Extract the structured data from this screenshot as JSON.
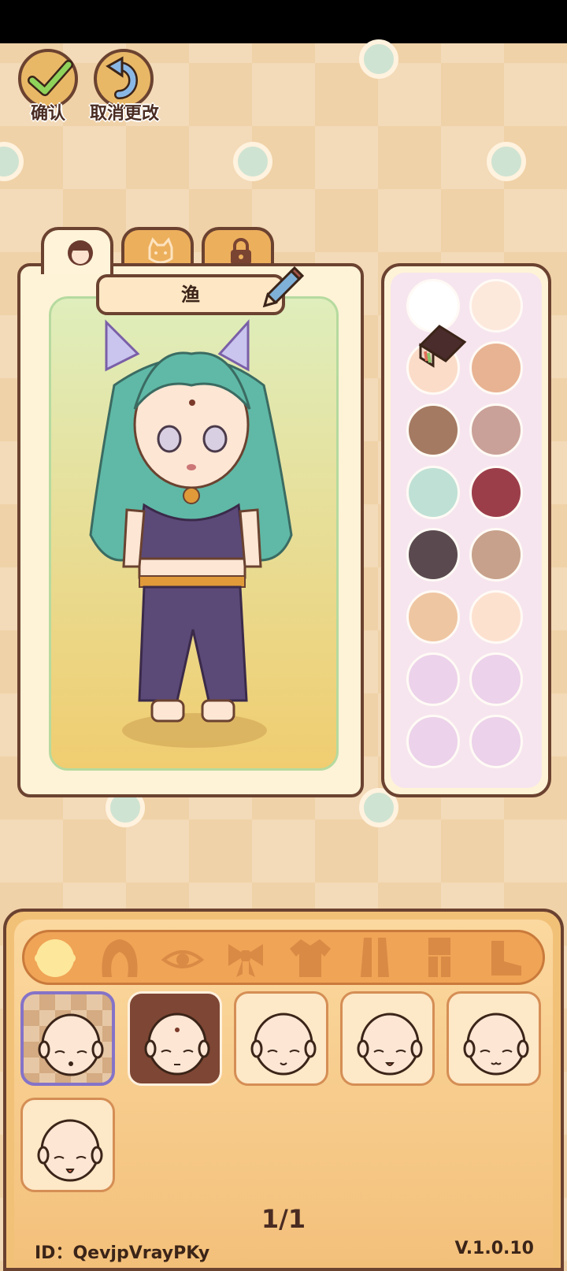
{
  "header": {
    "confirm_label": "确认",
    "cancel_label": "取消更改"
  },
  "tabs": [
    {
      "icon": "girl-face-icon",
      "active": true
    },
    {
      "icon": "cat-face-icon",
      "active": false
    },
    {
      "icon": "lock-icon",
      "active": false
    }
  ],
  "preview": {
    "character_name": "渔"
  },
  "palette": {
    "colors": [
      "#ffffff",
      "#fde8dc",
      "#fbdcc8",
      "#e8b393",
      "#a57a62",
      "#c9a198",
      "#bfe0d5",
      "#9c3e4a",
      "#5a4a4f",
      "#c7a18b",
      "#efc6a2",
      "#fde1cf",
      "#ecd2ea",
      "#ecd2ea",
      "#ecd2ea",
      "#ecd2ea"
    ]
  },
  "categories": [
    "face-shape-icon",
    "hair-icon",
    "eye-icon",
    "bow-icon",
    "top-icon",
    "dress-icon",
    "outfit-icon",
    "shoe-icon"
  ],
  "items": [
    "face-1",
    "face-2",
    "face-3",
    "face-4",
    "face-5",
    "face-6"
  ],
  "footer": {
    "page": "1/1",
    "id_text": "ID：QevjpVrayPKy",
    "version": "V.1.0.10"
  }
}
